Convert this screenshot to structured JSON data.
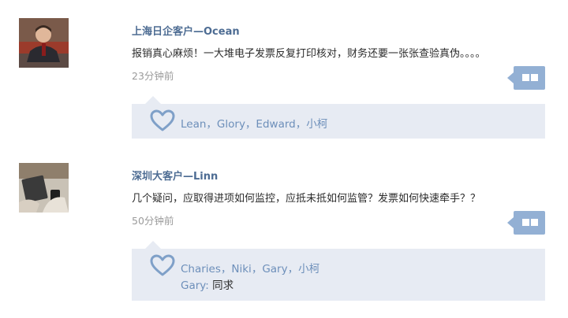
{
  "posts": [
    {
      "author": "上海日企客户—Ocean",
      "content": "报销真心麻烦！一大堆电子发票反复打印核对，财务还要一张张查验真伪。。。。",
      "time": "23分钟前",
      "likes": "Lean，Glory，Edward，小柯",
      "avatar_icon": "person-avatar-icon"
    },
    {
      "author": "深圳大客户—Linn",
      "content": "几个疑问，应取得进项如何监控，应抵未抵如何监管？发票如何快速牵手？？",
      "time": "50分钟前",
      "likes": "Charies，Niki，Gary，小柯",
      "comment_user": "Gary:",
      "comment_text": "同求",
      "avatar_icon": "workspace-avatar-icon"
    }
  ],
  "colors": {
    "author": "#4d6c93",
    "likes": "#6d8fba",
    "reply_button": "#93b0d4",
    "likes_box": "#e7ebf3",
    "time": "#9a9a9a"
  },
  "icons": {
    "reply": "speech-bubble-icon",
    "like": "heart-outline-icon"
  }
}
